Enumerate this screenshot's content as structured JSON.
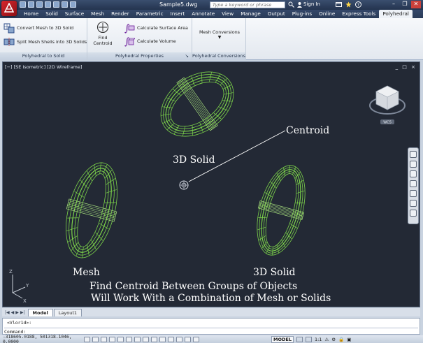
{
  "titlebar": {
    "document_title": "Sample5.dwg",
    "search_placeholder": "Type a keyword or phrase",
    "sign_in": "Sign In"
  },
  "ribbon_tabs": [
    "Home",
    "Solid",
    "Surface",
    "Mesh",
    "Render",
    "Parametric",
    "Insert",
    "Annotate",
    "View",
    "Manage",
    "Output",
    "Plug-ins",
    "Online",
    "Express Tools",
    "Polyhedral"
  ],
  "active_tab": "Polyhedral",
  "ribbon": {
    "to_solid_panel": {
      "convert_label": "Convert Mesh to 3D Solid",
      "split_label": "Split Mesh Shells into 3D Solids",
      "footer": "Polyhedral to Solid"
    },
    "properties_panel": {
      "find_centroid_label": "Find Centroid",
      "calc_area_label": "Calculate Surface Area",
      "calc_volume_label": "Calculate Volume",
      "footer": "Polyhedral Properties"
    },
    "conversions_panel": {
      "mesh_conversions_label": "Mesh Conversions",
      "footer": "Polyhedral Conversions"
    }
  },
  "viewport": {
    "label": "[−] [SE Isometric] [2D Wireframe]",
    "controls": "_ □ ×",
    "viewcube_badge": "WCS",
    "annotations": {
      "centroid": "Centroid",
      "top_solid": "3D Solid",
      "mesh": "Mesh",
      "right_solid": "3D Solid",
      "caption_line1": "Find Centroid Between Groups of Objects",
      "caption_line2": "Will Work With a Combination of Mesh or Solids"
    },
    "ucs_axes": {
      "x": "X",
      "y": "Y",
      "z": "Z"
    }
  },
  "layout_tabs": [
    "Model",
    "Layout1"
  ],
  "active_layout_tab": "Model",
  "command": {
    "history": "<Vlor1d>:",
    "prompt": "Command:"
  },
  "statusbar": {
    "coordinates": "-318605.0188, 501318.1046, 0.0000",
    "model_label": "MODEL",
    "scale": "1:1"
  },
  "colors": {
    "wire_green": "#7cd34a",
    "viewport_bg": "#232935",
    "ribbon_tab_bg": "#2a3b58"
  }
}
